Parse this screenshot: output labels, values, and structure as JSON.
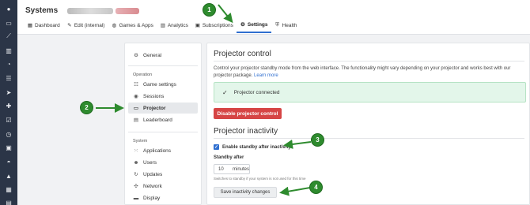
{
  "app": {
    "title": "Systems"
  },
  "tabs": [
    {
      "label": "Dashboard",
      "icon": "dashboard-icon"
    },
    {
      "label": "Edit (internal)",
      "icon": "pencil-icon"
    },
    {
      "label": "Games & Apps",
      "icon": "gamepad-icon"
    },
    {
      "label": "Analytics",
      "icon": "chart-icon"
    },
    {
      "label": "Subscriptions",
      "icon": "camera-icon"
    },
    {
      "label": "Settings",
      "icon": "gear-icon"
    },
    {
      "label": "Health",
      "icon": "shield-icon"
    }
  ],
  "sidebar": {
    "general": "General",
    "operation_header": "Operation",
    "operation_items": [
      "Game settings",
      "Sessions",
      "Projector",
      "Leaderboard"
    ],
    "system_header": "System",
    "system_items": [
      "Applications",
      "Users",
      "Updates",
      "Network",
      "Display"
    ]
  },
  "main": {
    "control_title": "Projector control",
    "control_desc": "Control your projector standby mode from the web interface. The functionality might vary depending on your projector and works best with our projector package.",
    "learn_more": "Learn more",
    "status_text": "Projector connected",
    "disable_label": "Disable projector control",
    "inactivity_title": "Projector inactivity",
    "enable_standby_label": "Enable standby after inactivity",
    "standby_after_label": "Standby after",
    "standby_value": "10",
    "standby_unit": "minutes",
    "hint": "Switches to standby if your system is not used for this time",
    "save_label": "Save inactivity changes"
  },
  "annotations": [
    "1",
    "2",
    "3",
    "4"
  ],
  "colors": {
    "accent": "#2f6fd0",
    "danger": "#d64545",
    "success_bg": "#e3f6ea",
    "sidebar_bg": "#2b3547",
    "annotation": "#2e8b2e"
  }
}
